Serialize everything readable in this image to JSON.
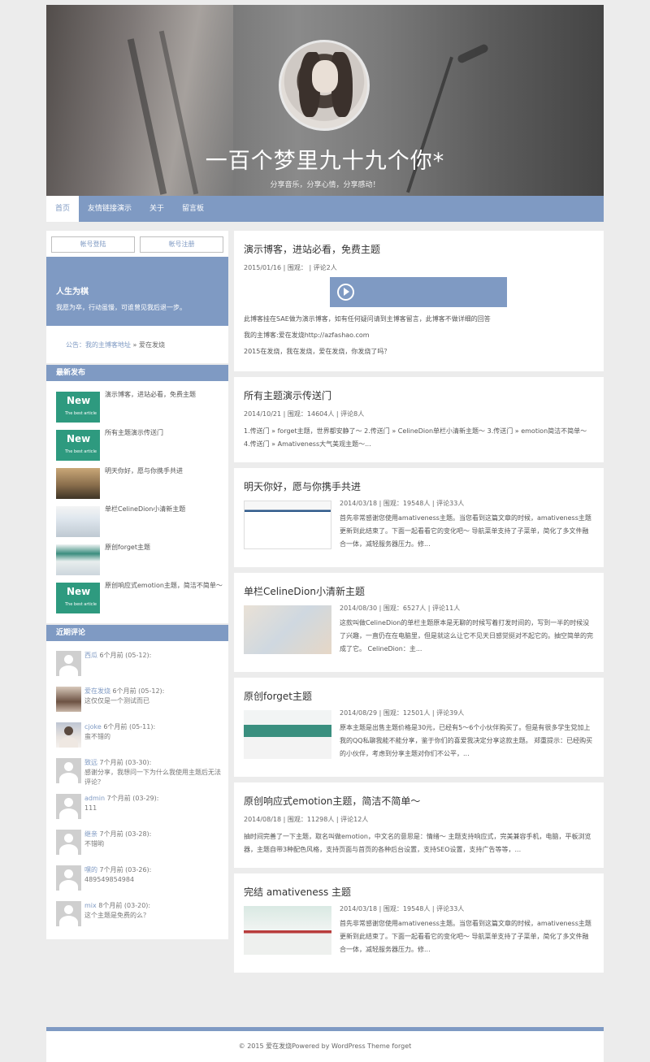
{
  "header": {
    "title": "一百个梦里九十九个你*",
    "tagline": "分享音乐，分享心情，分享感动！"
  },
  "nav": [
    "首页",
    "友情链接演示",
    "关于",
    "留言板"
  ],
  "account": {
    "login": "帐号登陆",
    "register": "帐号注册"
  },
  "profile": {
    "name": "人生为棋",
    "motto": "我愿为卒，行动虽慢，可谁曾见我后退一步。"
  },
  "notice": {
    "label": "公告：我的主博客地址",
    "rest": " » 爱在发烧"
  },
  "recent": {
    "title": "最新发布",
    "items": [
      {
        "thumb": "new",
        "badge": "New",
        "badge_sub": "The best article",
        "title": "演示博客，进站必看，免费主题"
      },
      {
        "thumb": "new",
        "badge": "New",
        "badge_sub": "The best article",
        "title": "所有主题演示传送门"
      },
      {
        "thumb": "photo",
        "title": "明天你好，愿与你携手共进"
      },
      {
        "thumb": "shot",
        "title": "单栏CelineDion小清新主题"
      },
      {
        "thumb": "shot2",
        "title": "原创forget主题"
      },
      {
        "thumb": "new",
        "badge": "New",
        "badge_sub": "The best article",
        "title": "原创响应式emotion主题，简洁不简单～"
      }
    ]
  },
  "comments": {
    "title": "近期评论",
    "items": [
      {
        "avatar": "default",
        "user": "西瓜",
        "time": "6个月前 (05-12):",
        "text": ""
      },
      {
        "avatar": "girl",
        "user": "爱在发烧",
        "time": "6个月前 (05-12):",
        "text": "这仅仅是一个测试而已"
      },
      {
        "avatar": "girl2",
        "user": "cjoke",
        "time": "6个月前 (05-11):",
        "text": "蛮不错的"
      },
      {
        "avatar": "default",
        "user": "致远",
        "time": "7个月前 (03-30):",
        "text": "感谢分享，我想问一下为什么我使用主题后无法评论？"
      },
      {
        "avatar": "default",
        "user": "admin",
        "time": "7个月前 (03-29):",
        "text": "111"
      },
      {
        "avatar": "default",
        "user": "继亲",
        "time": "7个月前 (03-28):",
        "text": "不错哟"
      },
      {
        "avatar": "default",
        "user": "嘿的",
        "time": "7个月前 (03-26):",
        "text": "489549854984"
      },
      {
        "avatar": "default",
        "user": "mix",
        "time": "8个月前 (03-20):",
        "text": "这个主题是免费的么？"
      }
    ]
  },
  "posts": [
    {
      "title": "演示博客，进站必看，免费主题",
      "meta": "2015/01/16 | 围观：",
      "meta_tail": "| 评论2人",
      "paragraphs": [
        "此博客挂在SAE做为演示博客，如有任何疑问请到主博客留言，此博客不做详细的回答",
        "我的主博客:爱在发烧http://azfashao.com",
        "2015在发烧，我在发烧，爱在发烧，你发烧了吗？"
      ]
    },
    {
      "title": "所有主题演示传送门",
      "meta": "2014/10/21 | 围观：14604人 | 评论8人",
      "excerpt": "1.传送门 » forget主题，世界都安静了～ 2.传送门 » CelineDion单栏小清新主题～ 3.传送门 » emotion简洁不简单～ 4.传送门 » Amativeness大气美观主题～..."
    },
    {
      "title": "明天你好，愿与你携手共进",
      "meta": "2014/03/18 | 围观：19548人 | 评论33人",
      "excerpt": "首先非常感谢您使用amativeness主题。当您看到这篇文章的时候，amativeness主题更新到此结束了。下面一起看看它的变化吧～ 导航菜单支持了子菜单，简化了多文件融合一体，减轻服务器压力。修..."
    },
    {
      "title": "单栏CelineDion小清新主题",
      "meta": "2014/08/30 | 围观：6527人 | 评论11人",
      "excerpt": "这款叫做CelineDion的单栏主题原本是无聊的时候写着打发时间的，写到一半的时候没了兴趣，一直仍在在电脑里，但是就这么让它不见天日感觉挺对不起它的。抽空简单的完成了它。 CelineDion：主..."
    },
    {
      "title": "原创forget主题",
      "meta": "2014/08/29 | 围观：12501人 | 评论39人",
      "excerpt": "原本主题是出售主题价格是30元，已经有5～6个小伙伴购买了。但是有很多学生党加上我的QQ私聊我能不能分享，鉴于你们的喜爱我决定分享这款主题。 郑重提示：已经购买的小伙伴，考虑到分享主题对你们不公平，..."
    },
    {
      "title": "原创响应式emotion主题，简洁不简单～",
      "meta": "2014/08/18 | 围观：11298人 | 评论12人",
      "excerpt": "抽时间完善了一下主题，取名叫做emotion，中文名的意思是：情绪～ 主题支持响应式，完美兼容手机，电脑，平板浏览器，主题自带3种配色风格，支持页面与首页的各种后台设置，支持SEO设置，支持广告等等，..."
    },
    {
      "title": "完结 amativeness 主题",
      "meta": "2014/03/18 | 围观：19548人 | 评论33人",
      "excerpt": "首先非常感谢您使用amativeness主题。当您看到这篇文章的时候，amativeness主题更新到此结束了。下面一起看看它的变化吧～ 导航菜单支持了子菜单，简化了多文件融合一体，减轻服务器压力。修..."
    }
  ],
  "footer": {
    "text": "© 2015 爱在发烧Powered by WordPress Theme forget"
  }
}
